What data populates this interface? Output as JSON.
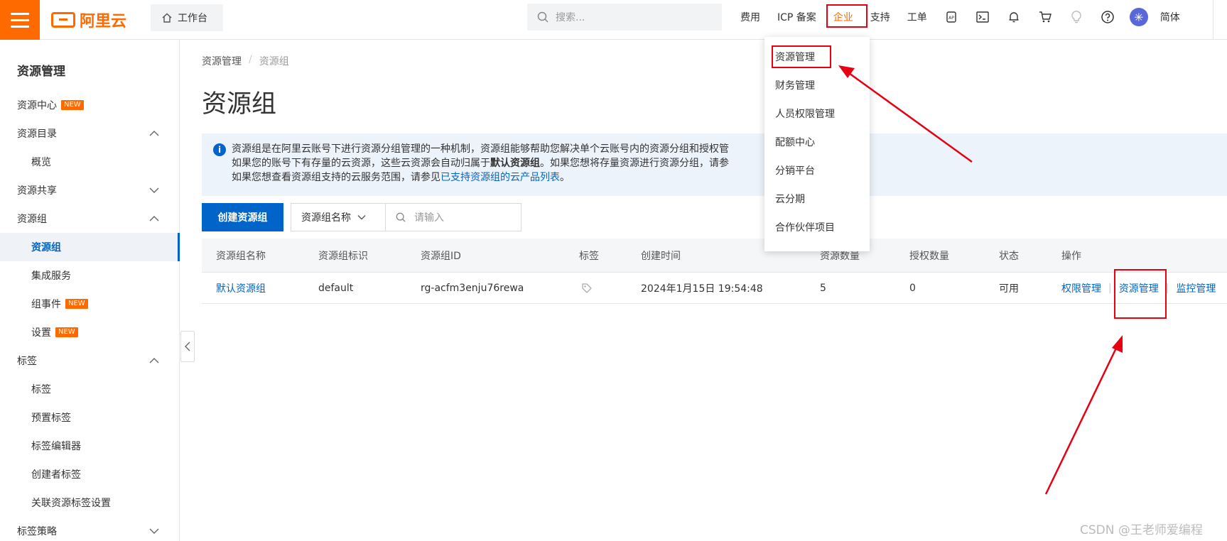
{
  "topbar": {
    "logo_text": "阿里云",
    "workbench_label": "工作台",
    "search_placeholder": "搜索...",
    "nav": [
      "费用",
      "ICP 备案",
      "企业",
      "支持",
      "工单"
    ],
    "active_nav": "企业",
    "lang": "简体"
  },
  "sidebar": {
    "title": "资源管理",
    "items": [
      {
        "label": "资源中心",
        "badge": "NEW"
      },
      {
        "label": "资源目录"
      },
      {
        "label": "概览"
      },
      {
        "label": "资源共享"
      },
      {
        "label": "资源组"
      },
      {
        "label": "资源组"
      },
      {
        "label": "集成服务"
      },
      {
        "label": "组事件",
        "badge": "NEW"
      },
      {
        "label": "设置",
        "badge": "NEW"
      },
      {
        "label": "标签"
      },
      {
        "label": "标签"
      },
      {
        "label": "预置标签"
      },
      {
        "label": "标签编辑器"
      },
      {
        "label": "创建者标签"
      },
      {
        "label": "关联资源标签设置"
      },
      {
        "label": "标签策略"
      }
    ]
  },
  "breadcrumb": [
    "资源管理",
    "/",
    "资源组"
  ],
  "page_title": "资源组",
  "info": {
    "line1": "资源组是在阿里云账号下进行资源分组管理的一种机制，资源组能够帮助您解决单个云账号内的资源分组和授权管",
    "line2_a": "如果您的账号下有存量的云资源，这些云资源会自动归属于",
    "line2_b": "默认资源组",
    "line2_c": "。如果您想将存量资源进行资源分组，请参",
    "line3_a": "如果您想查看资源组支持的云服务范围，请参见",
    "line3_link": "已支持资源组的云产品列表",
    "line3_c": "。"
  },
  "toolbar": {
    "create_label": "创建资源组",
    "filter_select": "资源组名称",
    "filter_placeholder": "请输入"
  },
  "table": {
    "headers": [
      "资源组名称",
      "资源组标识",
      "资源组ID",
      "标签",
      "创建时间",
      "资源数量",
      "授权数量",
      "状态",
      "操作"
    ],
    "row": {
      "name": "默认资源组",
      "ident": "default",
      "id": "rg-acfm3enju76rewa",
      "created": "2024年1月15日 19:54:48",
      "resources": "5",
      "auth": "0",
      "status": "可用",
      "ops": [
        "权限管理",
        "资源管理",
        "监控管理"
      ]
    }
  },
  "dropdown": [
    "资源管理",
    "财务管理",
    "人员权限管理",
    "配额中心",
    "分销平台",
    "云分期",
    "合作伙伴项目"
  ],
  "watermark": "CSDN @王老师爱编程",
  "colors": {
    "brand": "#ff6a00",
    "link": "#0064c8",
    "annotation": "#e60012"
  }
}
